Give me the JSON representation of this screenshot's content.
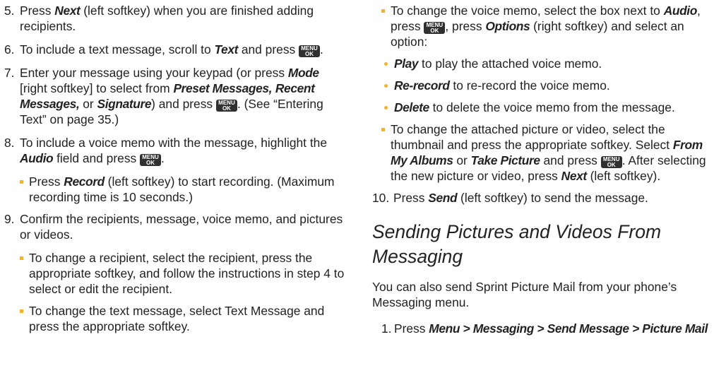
{
  "keys": {
    "menu_top": "MENU",
    "menu_bottom": "OK"
  },
  "left": {
    "step5": {
      "num": "5.",
      "t1": "Press ",
      "next": "Next",
      "t2": " (left softkey) when you are finished adding recipients."
    },
    "step6": {
      "num": "6.",
      "t1": "To include a text message, scroll to ",
      "text": "Text",
      "t2": " and press ",
      "t3": "."
    },
    "step7": {
      "num": "7.",
      "t1": "Enter your message using your keypad (or press ",
      "mode": "Mode",
      "t2": " [right softkey] to select from ",
      "preset": "Preset Messages,",
      "t3": " ",
      "recent": "Recent Messages,",
      "t4": " or ",
      "signature": "Signature",
      "t5": ") and press ",
      "t6": ". (See “Entering Text” on page 35.)"
    },
    "step8": {
      "num": "8.",
      "t1": "To include a voice memo with the message, highlight the ",
      "audio": "Audio",
      "t2": " field and press ",
      "t3": "."
    },
    "step8_sub": {
      "t1": "Press ",
      "record": "Record",
      "t2": " (left softkey) to start recording. (Maximum recording time is 10 seconds.)"
    },
    "step9": {
      "num": "9.",
      "t1": "Confirm the recipients, message, voice memo, and pictures or videos."
    },
    "step9_sub1": {
      "t1": "To change a recipient, select the recipient, press the appropriate softkey, and follow the instructions in step 4 to select or edit the recipient."
    },
    "step9_sub2": {
      "t1": "To change the text message, select Text Message and press the appropriate softkey."
    }
  },
  "right": {
    "voice": {
      "t1": "To change the voice memo, select the box next to ",
      "audio": "Audio",
      "t2": ", press ",
      "t3": ", press ",
      "options": "Options",
      "t4": " (right softkey) and select an option:"
    },
    "opt_play": {
      "label": "Play",
      "t": " to play the attached voice memo."
    },
    "opt_rerecord": {
      "label": "Re-record",
      "t": " to re-record the voice memo."
    },
    "opt_delete": {
      "label": "Delete",
      "t": " to delete the voice memo from the message."
    },
    "picture": {
      "t1": "To change the attached picture or video, select the thumbnail and press the appropriate softkey. Select ",
      "albums": "From My Albums",
      "t2": " or ",
      "take": "Take Picture",
      "t3": " and press ",
      "t4": ". After selecting the new picture or video, press ",
      "next": "Next",
      "t5": " (left softkey)."
    },
    "step10": {
      "num": "10.",
      "t1": "Press ",
      "send": "Send",
      "t2": " (left softkey) to send the message."
    },
    "heading": "Sending Pictures and Videos From Messaging",
    "intro": "You can also send Sprint Picture Mail from your phone’s Messaging menu.",
    "step1": {
      "num": "1.",
      "t1": "Press ",
      "path": "Menu > Messaging > Send Message > Picture Mail"
    }
  }
}
